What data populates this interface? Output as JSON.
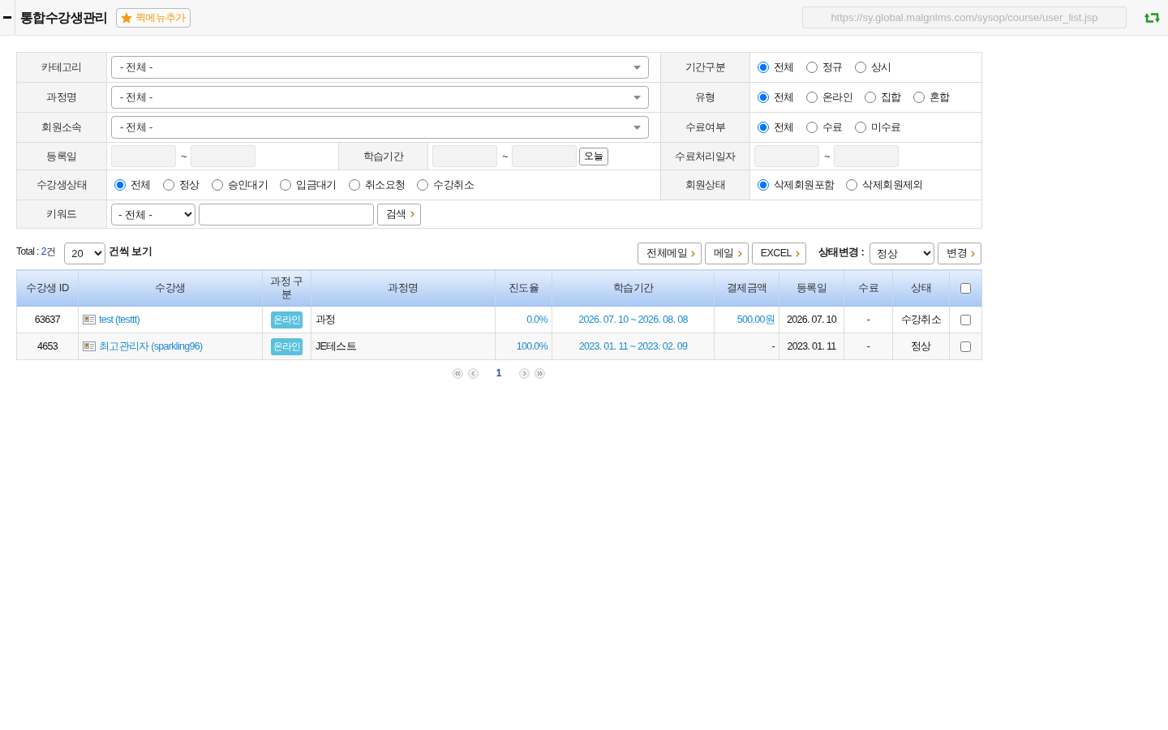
{
  "header": {
    "title": "통합수강생관리",
    "quick_menu_button": "퀵메뉴추가",
    "url": "https://sy.global.malgnlms.com/sysop/course/user_list.jsp"
  },
  "filters": {
    "category": {
      "label": "카테고리",
      "value": "- 전체 -"
    },
    "course_name": {
      "label": "과정명",
      "value": "- 전체 -"
    },
    "affiliation": {
      "label": "회원소속",
      "value": "- 전체 -"
    },
    "period_type": {
      "label": "기간구분",
      "options": [
        {
          "label": "전체",
          "selected": true
        },
        {
          "label": "정규",
          "selected": false
        },
        {
          "label": "상시",
          "selected": false
        }
      ]
    },
    "course_type": {
      "label": "유형",
      "options": [
        {
          "label": "전체",
          "selected": true
        },
        {
          "label": "온라인",
          "selected": false
        },
        {
          "label": "집합",
          "selected": false
        },
        {
          "label": "혼합",
          "selected": false
        }
      ]
    },
    "completion": {
      "label": "수료여부",
      "options": [
        {
          "label": "전체",
          "selected": true
        },
        {
          "label": "수료",
          "selected": false
        },
        {
          "label": "미수료",
          "selected": false
        }
      ]
    },
    "registration_date": {
      "label": "등록일",
      "separator": "~"
    },
    "study_period": {
      "label": "학습기간",
      "separator": "~",
      "today_button": "오늘"
    },
    "completion_date": {
      "label": "수료처리일자",
      "separator": "~"
    },
    "student_status": {
      "label": "수강생상태",
      "options": [
        {
          "label": "전체",
          "selected": true
        },
        {
          "label": "정상",
          "selected": false
        },
        {
          "label": "승인대기",
          "selected": false
        },
        {
          "label": "입금대기",
          "selected": false
        },
        {
          "label": "취소요청",
          "selected": false
        },
        {
          "label": "수강취소",
          "selected": false
        }
      ]
    },
    "member_status": {
      "label": "회원상태",
      "options": [
        {
          "label": "삭제회원포함",
          "selected": true
        },
        {
          "label": "삭제회원제외",
          "selected": false
        }
      ]
    },
    "keyword": {
      "label": "키워드",
      "field_type": "- 전체 -",
      "search_button": "검색"
    }
  },
  "toolbar": {
    "total_label": "Total :",
    "total_count": "2",
    "total_unit": "건",
    "page_size": "20",
    "page_size_label": "건씩 보기",
    "buttons": [
      "전체메일",
      "메일",
      "EXCEL"
    ],
    "status_change_label": "상태변경 :",
    "status_value": "정상",
    "apply_button": "변경"
  },
  "table": {
    "columns": [
      "수강생 ID",
      "수강생",
      "과정 구분",
      "과정명",
      "진도율",
      "학습기간",
      "결제금액",
      "등록일",
      "수료",
      "상태"
    ],
    "select_all_checked": false,
    "rows": [
      {
        "id": "63637",
        "student": "test (testtt)",
        "course_type": "온라인",
        "course_name": "과정",
        "progress": "0.0%",
        "study_period": "2026. 07. 10 ~ 2026. 08. 08",
        "payment": "500.00원",
        "payment_linked": true,
        "registered": "2026. 07. 10",
        "completed": "-",
        "status": "수강취소",
        "checked": false
      },
      {
        "id": "4653",
        "student": "최고관리자 (sparkling96)",
        "course_type": "온라인",
        "course_name": "JE테스트",
        "progress": "100.0%",
        "study_period": "2023. 01. 11 ~ 2023. 02. 09",
        "payment": "-",
        "payment_linked": false,
        "registered": "2023. 01. 11",
        "completed": "-",
        "status": "정상",
        "checked": false
      }
    ]
  },
  "pagination": {
    "pages": [
      {
        "label": "1",
        "selected": true
      }
    ]
  }
}
